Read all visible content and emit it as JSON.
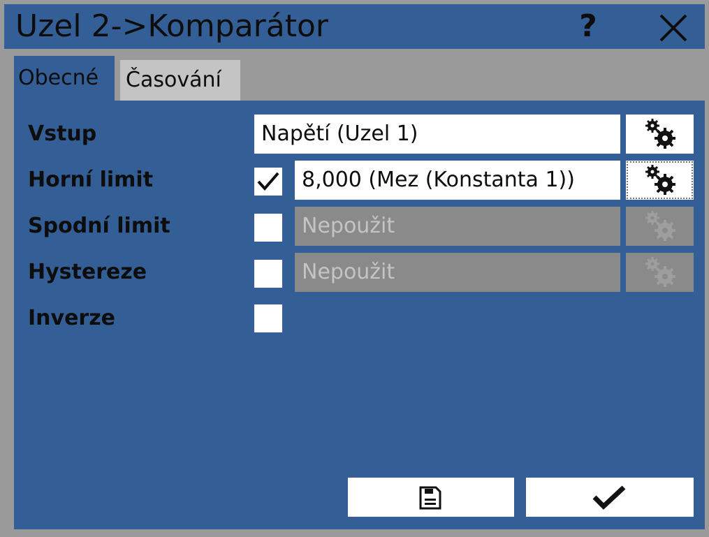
{
  "window": {
    "title": "Uzel 2->Komparátor",
    "help_label": "?"
  },
  "tabs": [
    {
      "label": "Obecné",
      "active": true
    },
    {
      "label": "Časování",
      "active": false
    }
  ],
  "rows": {
    "vstup": {
      "label": "Vstup",
      "value": "Napětí (Uzel 1)"
    },
    "horni": {
      "label": "Horní limit",
      "checked": true,
      "value": "8,000 (Mez (Konstanta 1))"
    },
    "spodni": {
      "label": "Spodní limit",
      "checked": false,
      "value": "Nepoužit"
    },
    "hystereze": {
      "label": "Hystereze",
      "checked": false,
      "value": "Nepoužit"
    },
    "inverze": {
      "label": "Inverze",
      "checked": false
    }
  },
  "buttons": {
    "save_icon": "floppy-disk-icon",
    "confirm_icon": "checkmark-icon"
  },
  "colors": {
    "accent": "#345f96",
    "background": "#9a9a9a",
    "disabled_field": "#8a8a8a"
  }
}
